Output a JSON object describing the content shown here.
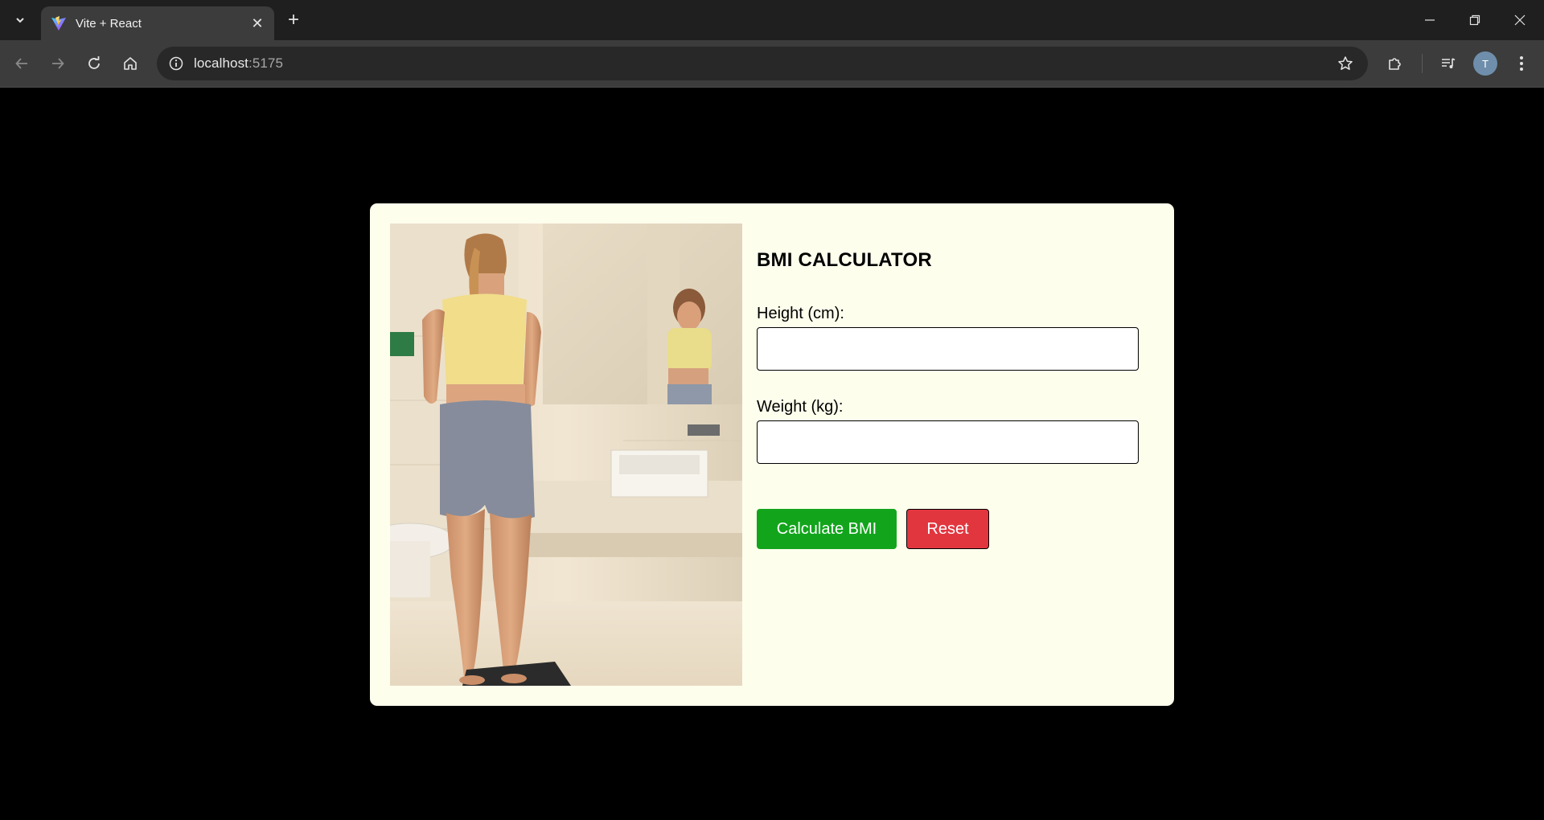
{
  "browser": {
    "tab": {
      "title": "Vite + React"
    },
    "address": {
      "host": "localhost",
      "port": ":5175"
    },
    "profile_initial": "T",
    "icons": [
      "tab-search-icon",
      "vite-favicon-icon",
      "close-icon",
      "plus-icon",
      "minimize-icon",
      "restore-icon",
      "close-window-icon",
      "back-arrow-icon",
      "forward-arrow-icon",
      "reload-icon",
      "home-icon",
      "site-info-icon",
      "star-icon",
      "extensions-icon",
      "media-queue-icon",
      "kebab-menu-icon"
    ]
  },
  "app": {
    "title": "BMI CALCULATOR",
    "height_label": "Height (cm):",
    "height_value": "",
    "weight_label": "Weight (kg):",
    "weight_value": "",
    "calculate_label": "Calculate BMI",
    "reset_label": "Reset",
    "colors": {
      "page_background": "#000000",
      "card_background": "#fefeed",
      "calculate_button": "#12a51c",
      "reset_button": "#e2363f"
    }
  }
}
